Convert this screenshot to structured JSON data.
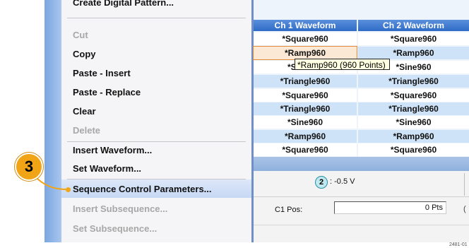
{
  "menu": {
    "items": [
      {
        "label": "Create Digital Pattern...",
        "enabled": true
      },
      {
        "label": "Cut",
        "enabled": false
      },
      {
        "label": "Copy",
        "enabled": true
      },
      {
        "label": "Paste - Insert",
        "enabled": true
      },
      {
        "label": "Paste - Replace",
        "enabled": true
      },
      {
        "label": "Clear",
        "enabled": true
      },
      {
        "label": "Delete",
        "enabled": false
      },
      {
        "label": "Insert Waveform...",
        "enabled": true
      },
      {
        "label": "Set Waveform...",
        "enabled": true
      },
      {
        "label": "Sequence Control Parameters...",
        "enabled": true,
        "highlighted": true
      },
      {
        "label": "Insert Subsequence...",
        "enabled": false
      },
      {
        "label": "Set Subsequence...",
        "enabled": false
      }
    ]
  },
  "callout": {
    "number": "3",
    "color": "#f2a417"
  },
  "table": {
    "headers": [
      "Ch 1 Waveform",
      "Ch 2 Waveform"
    ],
    "rows": [
      [
        "*Square960",
        "*Square960"
      ],
      [
        "*Ramp960",
        "*Ramp960"
      ],
      [
        "*Sine960",
        "*Sine960"
      ],
      [
        "*Triangle960",
        "*Triangle960"
      ],
      [
        "*Square960",
        "*Square960"
      ],
      [
        "*Triangle960",
        "*Triangle960"
      ],
      [
        "*Sine960",
        "*Sine960"
      ],
      [
        "*Ramp960",
        "*Ramp960"
      ],
      [
        "*Square960",
        "*Square960"
      ]
    ],
    "tooltip": "*Ramp960 (960 Points)"
  },
  "panel": {
    "channel_badge": "2",
    "value": ": -0.5 V",
    "pos_label": "C1 Pos:",
    "pos_value": "0 Pts",
    "edge_char": "("
  },
  "footer": {
    "figure_id": "2481-01"
  }
}
